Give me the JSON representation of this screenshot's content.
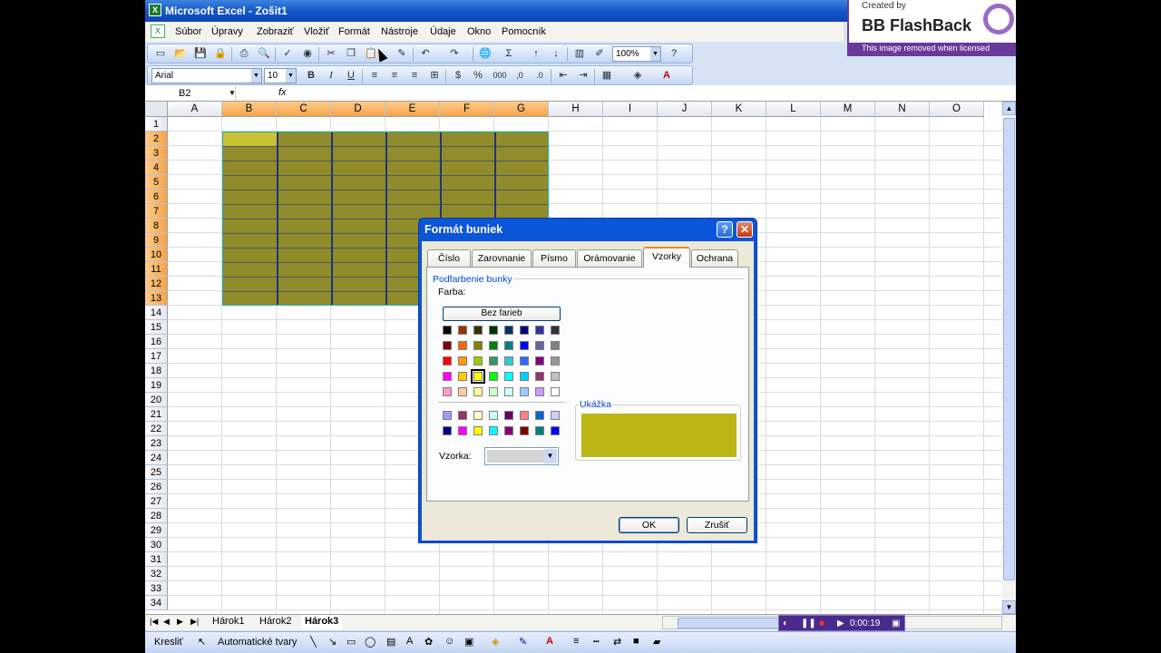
{
  "window": {
    "title": "Microsoft Excel - Zošit1"
  },
  "overlay": {
    "created_by": "Created by",
    "brand": "BB FlashBack",
    "notice": "This image removed when licensed"
  },
  "menu": [
    "Súbor",
    "Úpravy",
    "Zobraziť",
    "Vložiť",
    "Formát",
    "Nástroje",
    "Údaje",
    "Okno",
    "Pomocník"
  ],
  "toolbar": {
    "zoom": "100%",
    "font": "Arial",
    "size": "10",
    "bold": "B",
    "italic": "I",
    "underline": "U",
    "percent": "%",
    "thousands": "000",
    "sum": "Σ"
  },
  "formula_bar": {
    "name_box": "B2",
    "fx": "fx",
    "content": ""
  },
  "columns": [
    "A",
    "B",
    "C",
    "D",
    "E",
    "F",
    "G",
    "H",
    "I",
    "J",
    "K",
    "L",
    "M",
    "N",
    "O"
  ],
  "selected_columns": [
    "B",
    "C",
    "D",
    "E",
    "F",
    "G"
  ],
  "row_count": 34,
  "selected_rows": [
    2,
    13
  ],
  "sheets": [
    "Hárok1",
    "Hárok2",
    "Hárok3"
  ],
  "active_sheet": "Hárok3",
  "recorder": {
    "time": "0:00:19"
  },
  "drawing": {
    "draw": "Kresliť",
    "autoshapes": "Automatické tvary"
  },
  "dialog": {
    "title": "Formát buniek",
    "help": "?",
    "close": "✕",
    "tabs": [
      "Číslo",
      "Zarovnanie",
      "Písmo",
      "Orámovanie",
      "Vzorky",
      "Ochrana"
    ],
    "active_tab": "Vzorky",
    "group_label": "Podfarbenie bunky",
    "color_label": "Farba:",
    "no_color": "Bez farieb",
    "preview_label": "Ukážka",
    "pattern_label": "Vzorka:",
    "ok": "OK",
    "cancel": "Zrušiť",
    "selected_color": "#ffff00",
    "palette": [
      [
        "#000000",
        "#993300",
        "#333300",
        "#003300",
        "#003366",
        "#000080",
        "#333399",
        "#333333"
      ],
      [
        "#800000",
        "#ff6600",
        "#808000",
        "#008000",
        "#008080",
        "#0000ff",
        "#666699",
        "#808080"
      ],
      [
        "#ff0000",
        "#ff9900",
        "#99cc00",
        "#339966",
        "#33cccc",
        "#3366ff",
        "#800080",
        "#969696"
      ],
      [
        "#ff00ff",
        "#ffcc00",
        "#ffff00",
        "#00ff00",
        "#00ffff",
        "#00ccff",
        "#993366",
        "#c0c0c0"
      ],
      [
        "#ff99cc",
        "#ffcc99",
        "#ffff99",
        "#ccffcc",
        "#ccffff",
        "#99ccff",
        "#cc99ff",
        "#ffffff"
      ]
    ],
    "palette_extra": [
      [
        "#9999ff",
        "#993366",
        "#ffffcc",
        "#ccffff",
        "#660066",
        "#ff8080",
        "#0066cc",
        "#ccccff"
      ],
      [
        "#000080",
        "#ff00ff",
        "#ffff00",
        "#00ffff",
        "#800080",
        "#800000",
        "#008080",
        "#0000ff"
      ]
    ]
  }
}
